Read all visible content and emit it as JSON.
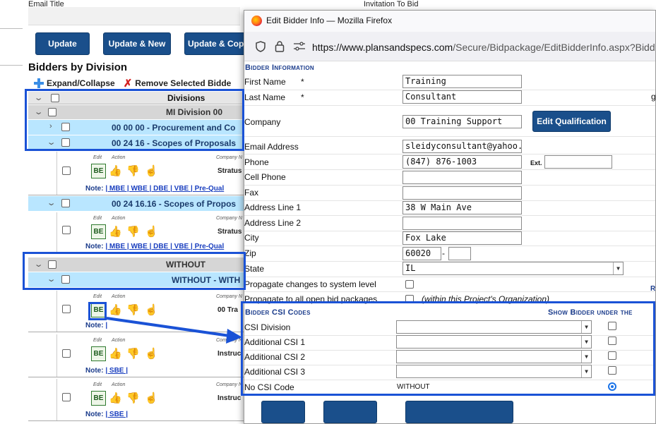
{
  "background": {
    "email_title": "Email Title",
    "invitation": "Invitation To Bid",
    "buttons": {
      "update": "Update",
      "update_new": "Update & New",
      "update_copy": "Update & Cop"
    },
    "section_title": "Bidders by Division",
    "expand_collapse": "Expand/Collapse",
    "remove_selected": "Remove Selected Bidde",
    "divisions_header": "Divisions",
    "rows": {
      "mi_division": "MI Division 00",
      "procurement": "00 00 00 - Procurement and Co",
      "scopes": "00 24 16 - Scopes of Proposals",
      "scopes2": "00 24 16.16 - Scopes of Propos",
      "without": "WITHOUT",
      "without2": "WITHOUT - WITH"
    },
    "card_labels": {
      "edit": "Edit",
      "action": "Action",
      "company": "Company N"
    },
    "be": "BE",
    "note_label": "Note:",
    "cards": [
      {
        "company": "Stratus",
        "links": "| MBE | WBE | DBE | VBE | Pre-Qual"
      },
      {
        "company": "Stratus",
        "links": "| MBE | WBE | DBE | VBE | Pre-Qual"
      },
      {
        "company": "00 Tra",
        "links": "|"
      },
      {
        "company": "Instruc",
        "links": "| SBE |"
      },
      {
        "company": "Instruc",
        "links": "| SBE |"
      }
    ],
    "right_edge": {
      "a": "g",
      "b": "R"
    }
  },
  "popup": {
    "window_title": "Edit Bidder Info — Mozilla Firefox",
    "url_base": "https://www.plansandspecs.com",
    "url_path": "/Secure/Bidpackage/EditBidderInfo.aspx?Bidde",
    "info_header": "Bidder Information",
    "labels": {
      "first_name": "First Name",
      "last_name": "Last Name",
      "required": "*",
      "company": "Company",
      "email": "Email Address",
      "phone": "Phone",
      "ext": "Ext.",
      "cell": "Cell Phone",
      "fax": "Fax",
      "addr1": "Address Line 1",
      "addr2": "Address Line 2",
      "city": "City",
      "zip": "Zip",
      "zip_dash": "-",
      "state": "State",
      "propagate_system": "Propagate changes to system level",
      "propagate_all": "Propagate to all open bid packages",
      "propagate_note": "(within this Project's Organization)"
    },
    "values": {
      "first_name": "Training",
      "last_name": "Consultant",
      "company": "00 Training Support",
      "email": "sleidyconsultant@yahoo.co",
      "phone": "(847) 876-1003",
      "ext": "",
      "cell": "",
      "fax": "",
      "addr1": "38 W Main Ave",
      "addr2": "",
      "city": "Fox Lake",
      "zip": "60020",
      "zip_ext": "",
      "state": "IL"
    },
    "edit_qualification": "Edit Qualification",
    "csi_header": "Bidder CSI Codes",
    "csi_show_header": "Show Bidder under the",
    "csi_rows": {
      "csi_division": "CSI Division",
      "additional1": "Additional CSI 1",
      "additional2": "Additional CSI 2",
      "additional3": "Additional CSI 3",
      "no_csi": "No CSI Code",
      "no_csi_value": "WITHOUT"
    }
  },
  "colors": {
    "accent_blue": "#1a4f8b",
    "highlight": "#1a52d6",
    "row_blue": "#b9e6ff",
    "row_gray": "#d6d6d6"
  }
}
